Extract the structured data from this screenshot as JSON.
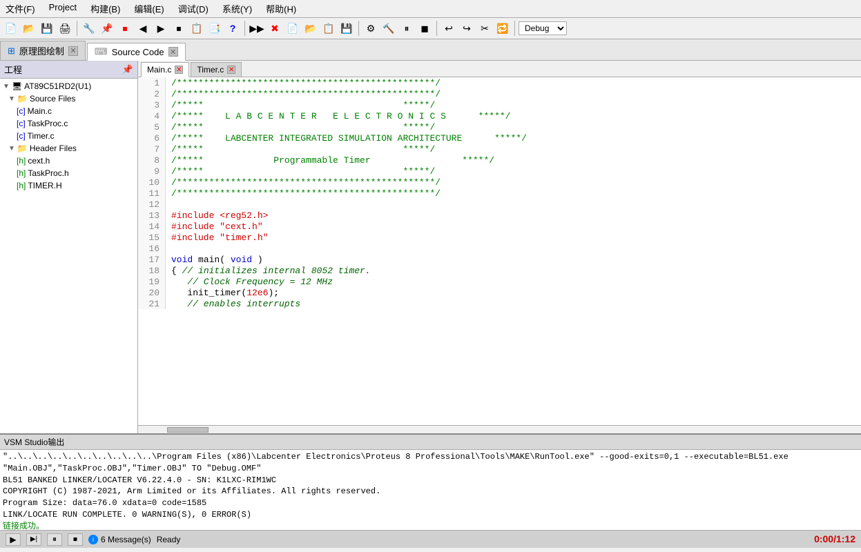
{
  "menu": {
    "items": [
      "文件(F)",
      "Project",
      "构建(B)",
      "编辑(E)",
      "调试(D)",
      "系统(Y)",
      "帮助(H)"
    ]
  },
  "toolbar": {
    "debug_value": "Debug",
    "buttons": [
      "📄",
      "📂",
      "💾",
      "🖨",
      "🔧",
      "📌",
      "🔴",
      "◀",
      "▶",
      "⏹",
      "📋",
      "📑",
      "❓",
      "▶▶",
      "✖",
      "📄",
      "📂",
      "📋",
      "💾",
      "⚙",
      "🔨",
      "⏸",
      "◼",
      "↩",
      "↪",
      "✂",
      "🔁"
    ]
  },
  "tabs": {
    "main_tabs": [
      {
        "label": "原理图绘制",
        "active": false,
        "closable": true
      },
      {
        "label": "Source Code",
        "active": true,
        "closable": true
      }
    ]
  },
  "left_panel": {
    "header": "工程",
    "tree": [
      {
        "label": "AT89C51RD2(U1)",
        "level": 0,
        "type": "root",
        "expanded": true
      },
      {
        "label": "Source Files",
        "level": 1,
        "type": "folder",
        "expanded": true
      },
      {
        "label": "Main.c",
        "level": 2,
        "type": "c"
      },
      {
        "label": "TaskProc.c",
        "level": 2,
        "type": "c"
      },
      {
        "label": "Timer.c",
        "level": 2,
        "type": "c"
      },
      {
        "label": "Header Files",
        "level": 1,
        "type": "folder",
        "expanded": true
      },
      {
        "label": "cext.h",
        "level": 2,
        "type": "h"
      },
      {
        "label": "TaskProc.h",
        "level": 2,
        "type": "h"
      },
      {
        "label": "TIMER.H",
        "level": 2,
        "type": "h"
      }
    ]
  },
  "sub_tabs": [
    {
      "label": "Main.c",
      "active": true,
      "closable": true
    },
    {
      "label": "Timer.c",
      "active": false,
      "closable": true
    }
  ],
  "code": {
    "lines": [
      {
        "num": 1,
        "content": "/**********************************************/",
        "style": "green"
      },
      {
        "num": 2,
        "content": "/**********************************************/",
        "style": "green"
      },
      {
        "num": 3,
        "content": "/*****                              *****/",
        "style": "green"
      },
      {
        "num": 4,
        "content": "/*****    L A B C E N T E R   E L E C T R O N I C S      *****/",
        "style": "green"
      },
      {
        "num": 5,
        "content": "/*****                              *****/",
        "style": "green"
      },
      {
        "num": 6,
        "content": "/*****    LABCENTER INTEGRATED SIMULATION ARCHITECTURE      *****/",
        "style": "green"
      },
      {
        "num": 7,
        "content": "/*****                              *****/",
        "style": "green"
      },
      {
        "num": 8,
        "content": "/*****             Programmable Timer                *****/",
        "style": "green"
      },
      {
        "num": 9,
        "content": "/*****                              *****/",
        "style": "green"
      },
      {
        "num": 10,
        "content": "/**********************************************/",
        "style": "green"
      },
      {
        "num": 11,
        "content": "/**********************************************/",
        "style": "green"
      },
      {
        "num": 12,
        "content": "",
        "style": "normal"
      },
      {
        "num": 13,
        "content": "#include <reg52.h>",
        "style": "red"
      },
      {
        "num": 14,
        "content": "#include \"cext.h\"",
        "style": "red"
      },
      {
        "num": 15,
        "content": "#include \"timer.h\"",
        "style": "red"
      },
      {
        "num": 16,
        "content": "",
        "style": "normal"
      },
      {
        "num": 17,
        "content": "void main( void )",
        "style": "mixed_void"
      },
      {
        "num": 18,
        "content": "{ // initializes internal 8052 timer.",
        "style": "comment_italic"
      },
      {
        "num": 19,
        "content": "   // Clock Frequency = 12 MHz",
        "style": "comment_italic"
      },
      {
        "num": 20,
        "content": "   init_timer(12e6);",
        "style": "mixed_timer"
      },
      {
        "num": 21,
        "content": "   // enables interrupts",
        "style": "comment_italic"
      }
    ]
  },
  "bottom_panel": {
    "header": "VSM Studio输出",
    "lines": [
      {
        "text": "\"..\\..\\..\\..\\..\\..\\..\\..\\..\\..\\Program Files (x86)\\Labcenter Electronics\\Proteus 8 Professional\\Tools\\MAKE\\RunTool.exe\" --good-exits=0,1 --executable=BL51.exe \"Main.OBJ\",\"TaskProc.OBJ\",\"Timer.OBJ\" TO \"Debug.OMF\"",
        "style": "normal"
      },
      {
        "text": "",
        "style": "normal"
      },
      {
        "text": "BL51 BANKED LINKER/LOCATER V6.22.4.0 - SN: K1LXC-RIM1WC",
        "style": "normal"
      },
      {
        "text": "COPYRIGHT (C) 1987-2021, Arm Limited or its Affiliates. All rights reserved.",
        "style": "normal"
      },
      {
        "text": "",
        "style": "normal"
      },
      {
        "text": "Program Size: data=76.0 xdata=0 code=1585",
        "style": "normal"
      },
      {
        "text": "LINK/LOCATE RUN COMPLETE.  0 WARNING(S),  0 ERROR(S)",
        "style": "normal"
      },
      {
        "text": "链接成功。",
        "style": "green"
      }
    ]
  },
  "status": {
    "play_label": "▶",
    "step_label": "▶|",
    "pause_label": "⏸",
    "stop_label": "⏹",
    "message_count": "6 Message(s)",
    "ready_text": "Ready",
    "time": "0:00/1:12"
  }
}
